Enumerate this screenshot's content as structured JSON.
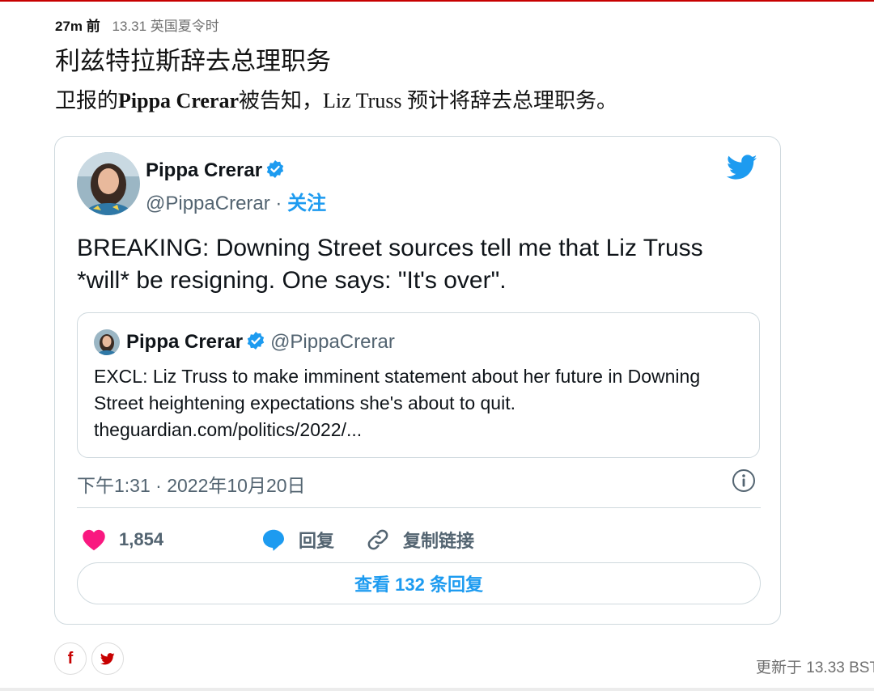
{
  "meta": {
    "ago": "27m 前",
    "time": "13.31 英国夏令时"
  },
  "headline": "利兹特拉斯辞去总理职务",
  "lede": {
    "prefix": "卫报的",
    "bold_name": "Pippa Crerar",
    "suffix": "被告知，Liz Truss 预计将辞去总理职务。"
  },
  "tweet": {
    "author_name": "Pippa Crerar",
    "handle": "@PippaCrerar",
    "separator": " · ",
    "follow_label": "关注",
    "text": "BREAKING: Downing Street sources tell me that Liz Truss *will* be resigning. One says: \"It's over\".",
    "quote": {
      "author_name": "Pippa Crerar",
      "handle": "@PippaCrerar",
      "text": "EXCL: Liz Truss to make imminent statement about her future in Downing Street heightening expectations she's about to quit. theguardian.com/politics/2022/..."
    },
    "timestamp": "下午1:31 · 2022年10月20日",
    "likes": "1,854",
    "reply_label": "回复",
    "copy_link_label": "复制链接",
    "view_replies_label": "查看 132 条回复"
  },
  "share": {
    "facebook_glyph": "f",
    "twitter_glyph": "t"
  },
  "updated": "更新于 13.33 BST",
  "colors": {
    "accent": "#1d9bf0",
    "heart": "#f91880",
    "guardian_red": "#c70000"
  }
}
